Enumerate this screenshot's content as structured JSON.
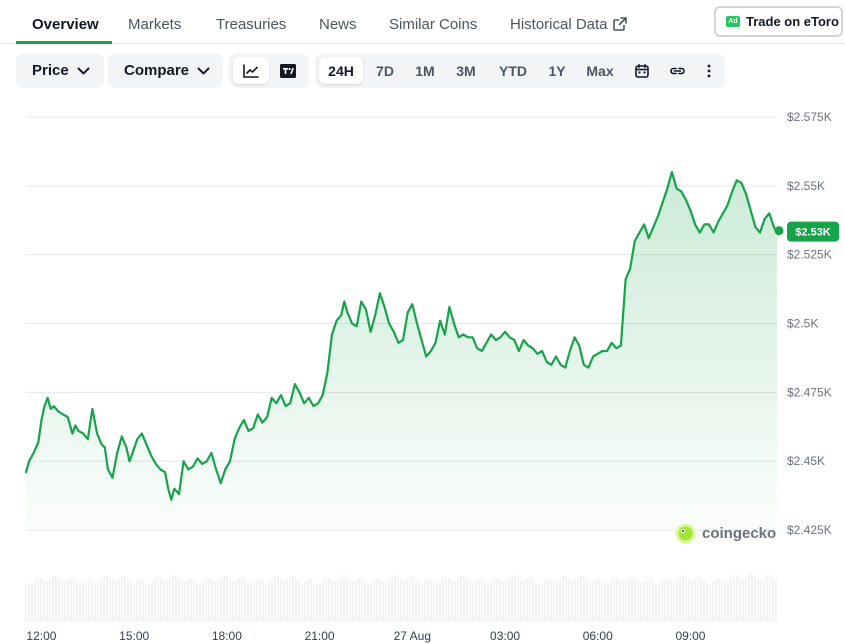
{
  "tabs": [
    "Overview",
    "Markets",
    "Treasuries",
    "News",
    "Similar Coins",
    "Historical Data"
  ],
  "trade_button": {
    "ad": "Ad",
    "label": "Trade on eToro"
  },
  "toolbar": {
    "price_label": "Price",
    "compare_label": "Compare",
    "ranges": [
      "24H",
      "7D",
      "1M",
      "3M",
      "YTD",
      "1Y",
      "Max"
    ],
    "active_range": "24H"
  },
  "watermark": "coingecko",
  "colors": {
    "line": "#16a34a",
    "accent": "#16a34a",
    "price_tag": "#16a34a"
  },
  "icons": [
    "line-chart-icon",
    "tradingview-icon",
    "calendar-icon",
    "link-icon",
    "more-vertical-icon",
    "external-link-icon",
    "chevron-down-icon"
  ],
  "chart_data": {
    "type": "area",
    "title": "",
    "xlabel": "",
    "ylabel": "",
    "ylim": [
      2425,
      2575
    ],
    "y_ticks": [
      2425,
      2450,
      2475,
      2500,
      2525,
      2550,
      2575
    ],
    "y_tick_labels": [
      "$2.425K",
      "$2.45K",
      "$2.475K",
      "$2.5K",
      "$2.525K",
      "$2.55K",
      "$2.575K"
    ],
    "x_ticks": [
      12,
      15,
      18,
      21,
      24,
      27,
      30,
      33
    ],
    "x_tick_labels": [
      "12:00",
      "15:00",
      "18:00",
      "21:00",
      "27 Aug",
      "03:00",
      "06:00",
      "09:00"
    ],
    "xlim": [
      11.5,
      35.8
    ],
    "current_price_label": "$2.53K",
    "current_price": 2533,
    "grid": true,
    "legend": "none",
    "series": [
      {
        "x": [
          11.5,
          11.6,
          11.75,
          11.9,
          12.0,
          12.1,
          12.2,
          12.3,
          12.4,
          12.55,
          12.7,
          12.85,
          13.0,
          13.1,
          13.2,
          13.35,
          13.5,
          13.65,
          13.8,
          13.95,
          14.05,
          14.15,
          14.3,
          14.45,
          14.6,
          14.75,
          14.85,
          14.95,
          15.1,
          15.25,
          15.4,
          15.55,
          15.7,
          15.85,
          16.0,
          16.1,
          16.2,
          16.3,
          16.45,
          16.6,
          16.75,
          16.9,
          17.05,
          17.2,
          17.35,
          17.5,
          17.65,
          17.8,
          17.95,
          18.1,
          18.25,
          18.4,
          18.55,
          18.7,
          18.85,
          19.0,
          19.15,
          19.3,
          19.45,
          19.6,
          19.75,
          19.9,
          20.05,
          20.2,
          20.35,
          20.5,
          20.65,
          20.8,
          20.95,
          21.1,
          21.25,
          21.4,
          21.55,
          21.7,
          21.8,
          21.9,
          22.05,
          22.2,
          22.35,
          22.5,
          22.65,
          22.8,
          22.95,
          23.1,
          23.25,
          23.4,
          23.55,
          23.7,
          23.85,
          24.0,
          24.15,
          24.3,
          24.45,
          24.6,
          24.75,
          24.9,
          25.05,
          25.2,
          25.35,
          25.5,
          25.65,
          25.8,
          25.95,
          26.1,
          26.25,
          26.4,
          26.55,
          26.7,
          26.85,
          27.0,
          27.15,
          27.3,
          27.45,
          27.6,
          27.75,
          27.9,
          28.05,
          28.2,
          28.35,
          28.5,
          28.65,
          28.8,
          28.95,
          29.1,
          29.25,
          29.4,
          29.55,
          29.7,
          29.85,
          30.0,
          30.15,
          30.3,
          30.45,
          30.6,
          30.75,
          30.9,
          31.05,
          31.2,
          31.35,
          31.5,
          31.65,
          31.8,
          31.95,
          32.1,
          32.25,
          32.4,
          32.55,
          32.7,
          32.85,
          33.0,
          33.15,
          33.3,
          33.45,
          33.6,
          33.75,
          33.9,
          34.05,
          34.2,
          34.35,
          34.5,
          34.65,
          34.8,
          34.95,
          35.1,
          35.25,
          35.4,
          35.55,
          35.7,
          35.8
        ],
        "y": [
          2446,
          2450,
          2453,
          2457,
          2465,
          2470,
          2473,
          2469,
          2470,
          2468,
          2467,
          2466,
          2460,
          2463,
          2461,
          2460,
          2458,
          2469,
          2460,
          2456,
          2455,
          2447,
          2444,
          2453,
          2459,
          2455,
          2450,
          2453,
          2458,
          2460,
          2456,
          2452,
          2449,
          2447,
          2446,
          2440,
          2436,
          2440,
          2438,
          2450,
          2447,
          2448,
          2451,
          2449,
          2450,
          2453,
          2447,
          2442,
          2447,
          2450,
          2458,
          2462,
          2465,
          2461,
          2462,
          2467,
          2464,
          2466,
          2473,
          2471,
          2474,
          2470,
          2471,
          2478,
          2475,
          2471,
          2473,
          2470,
          2471,
          2474,
          2482,
          2496,
          2501,
          2503,
          2508,
          2504,
          2500,
          2499,
          2508,
          2505,
          2497,
          2503,
          2511,
          2506,
          2500,
          2497,
          2493,
          2494,
          2504,
          2507,
          2500,
          2494,
          2488,
          2490,
          2493,
          2501,
          2496,
          2506,
          2500,
          2495,
          2496,
          2495,
          2495,
          2491,
          2490,
          2493,
          2496,
          2494,
          2495,
          2497,
          2495,
          2494,
          2490,
          2494,
          2492,
          2491,
          2489,
          2490,
          2486,
          2485,
          2488,
          2485,
          2484,
          2490,
          2495,
          2492,
          2485,
          2484,
          2488,
          2489,
          2490,
          2490,
          2493,
          2491,
          2492,
          2516,
          2520,
          2530,
          2533,
          2536,
          2531,
          2535,
          2539,
          2544,
          2549,
          2555,
          2549,
          2548,
          2545,
          2541,
          2536,
          2533,
          2536,
          2536,
          2533,
          2537,
          2540,
          2543,
          2548,
          2552,
          2551,
          2547,
          2541,
          2535,
          2533,
          2538,
          2540,
          2535,
          2533
        ]
      }
    ]
  }
}
